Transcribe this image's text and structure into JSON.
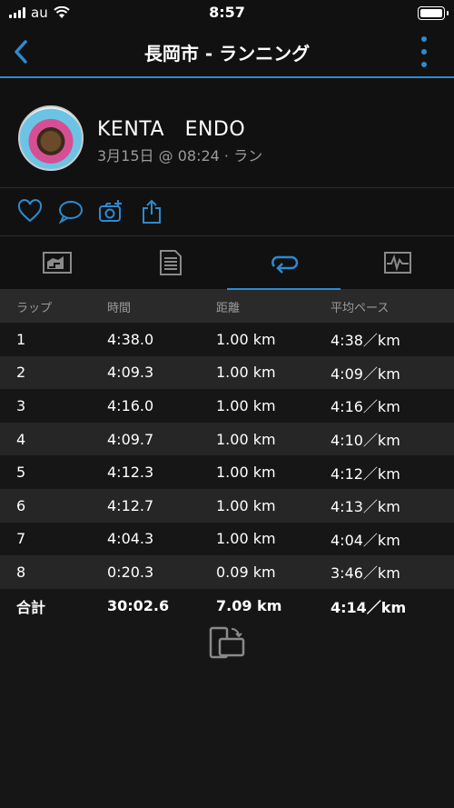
{
  "status_bar": {
    "carrier": "au",
    "time": "8:57"
  },
  "nav": {
    "title": "長岡市 - ランニング"
  },
  "profile": {
    "name": "KENTA　ENDO",
    "meta": "3月15日 @ 08:24 · ラン"
  },
  "actions": [
    "heart-icon",
    "comment-icon",
    "camera-add-icon",
    "share-icon"
  ],
  "tabs": [
    {
      "icon": "summary-chart-icon",
      "active": false
    },
    {
      "icon": "details-list-icon",
      "active": false
    },
    {
      "icon": "laps-icon",
      "active": true
    },
    {
      "icon": "graph-icon",
      "active": false
    }
  ],
  "laps_table": {
    "headers": [
      "ラップ",
      "時間",
      "距離",
      "平均ペース"
    ],
    "rows": [
      [
        "1",
        "4:38.0",
        "1.00 km",
        "4:38／km"
      ],
      [
        "2",
        "4:09.3",
        "1.00 km",
        "4:09／km"
      ],
      [
        "3",
        "4:16.0",
        "1.00 km",
        "4:16／km"
      ],
      [
        "4",
        "4:09.7",
        "1.00 km",
        "4:10／km"
      ],
      [
        "5",
        "4:12.3",
        "1.00 km",
        "4:12／km"
      ],
      [
        "6",
        "4:12.7",
        "1.00 km",
        "4:13／km"
      ],
      [
        "7",
        "4:04.3",
        "1.00 km",
        "4:04／km"
      ],
      [
        "8",
        "0:20.3",
        "0.09 km",
        "3:46／km"
      ]
    ],
    "total": [
      "合計",
      "30:02.6",
      "7.09 km",
      "4:14／km"
    ]
  },
  "colors": {
    "accent": "#2e8ad0",
    "background": "#161616",
    "row_alt": "#262626"
  }
}
